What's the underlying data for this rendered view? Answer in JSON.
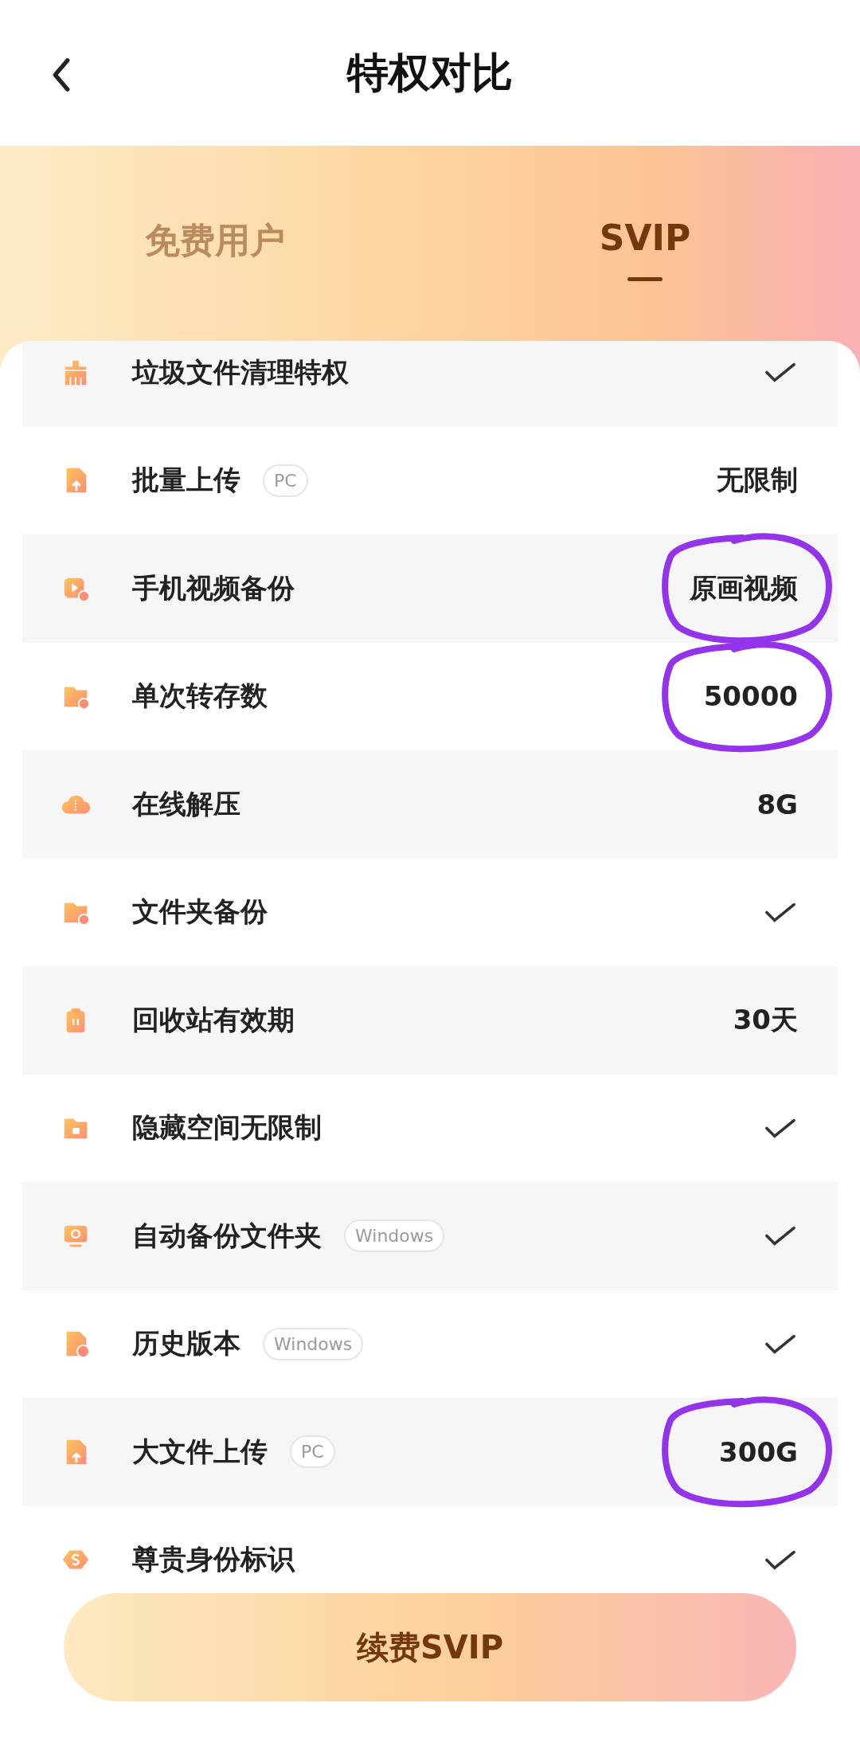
{
  "header": {
    "title": "特权对比"
  },
  "tabs": [
    {
      "label": "免费用户",
      "selected": false
    },
    {
      "label": "SVIP",
      "selected": true
    }
  ],
  "rows": [
    {
      "label": "垃圾文件清理特权",
      "kind": "check"
    },
    {
      "label": "批量上传",
      "tag": "PC",
      "kind": "text",
      "value": "无限制"
    },
    {
      "label": "手机视频备份",
      "kind": "text",
      "value": "原画视频",
      "circled": true
    },
    {
      "label": "单次转存数",
      "kind": "text",
      "value": "50000",
      "circled": true
    },
    {
      "label": "在线解压",
      "kind": "text",
      "value": "8G"
    },
    {
      "label": "文件夹备份",
      "kind": "check"
    },
    {
      "label": "回收站有效期",
      "kind": "text",
      "value": "30天"
    },
    {
      "label": "隐藏空间无限制",
      "kind": "check"
    },
    {
      "label": "自动备份文件夹",
      "tag": "Windows",
      "kind": "check"
    },
    {
      "label": "历史版本",
      "tag": "Windows",
      "kind": "check"
    },
    {
      "label": "大文件上传",
      "tag": "PC",
      "kind": "text",
      "value": "300G",
      "circled": true
    },
    {
      "label": "尊贵身份标识",
      "kind": "check"
    }
  ],
  "renew_button": "续费SVIP"
}
